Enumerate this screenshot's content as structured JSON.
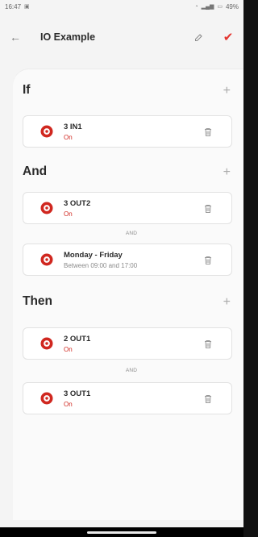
{
  "status": {
    "time": "16:47",
    "battery": "49%"
  },
  "header": {
    "title": "IO Example"
  },
  "sections": {
    "if": {
      "title": "If",
      "items": [
        {
          "title": "3 IN1",
          "subtitle": "On"
        }
      ]
    },
    "and": {
      "title": "And",
      "items": [
        {
          "title": "3 OUT2",
          "subtitle": "On"
        },
        {
          "title": "Monday - Friday",
          "subtitle": "Between 09:00 and 17:00"
        }
      ],
      "separator": "AND"
    },
    "then": {
      "title": "Then",
      "items": [
        {
          "title": "2 OUT1",
          "subtitle": "On"
        },
        {
          "title": "3 OUT1",
          "subtitle": "On"
        }
      ],
      "separator": "AND"
    }
  },
  "colors": {
    "accent": "#e3342f",
    "text": "#2b2b2b",
    "muted": "#8c8c8c"
  }
}
